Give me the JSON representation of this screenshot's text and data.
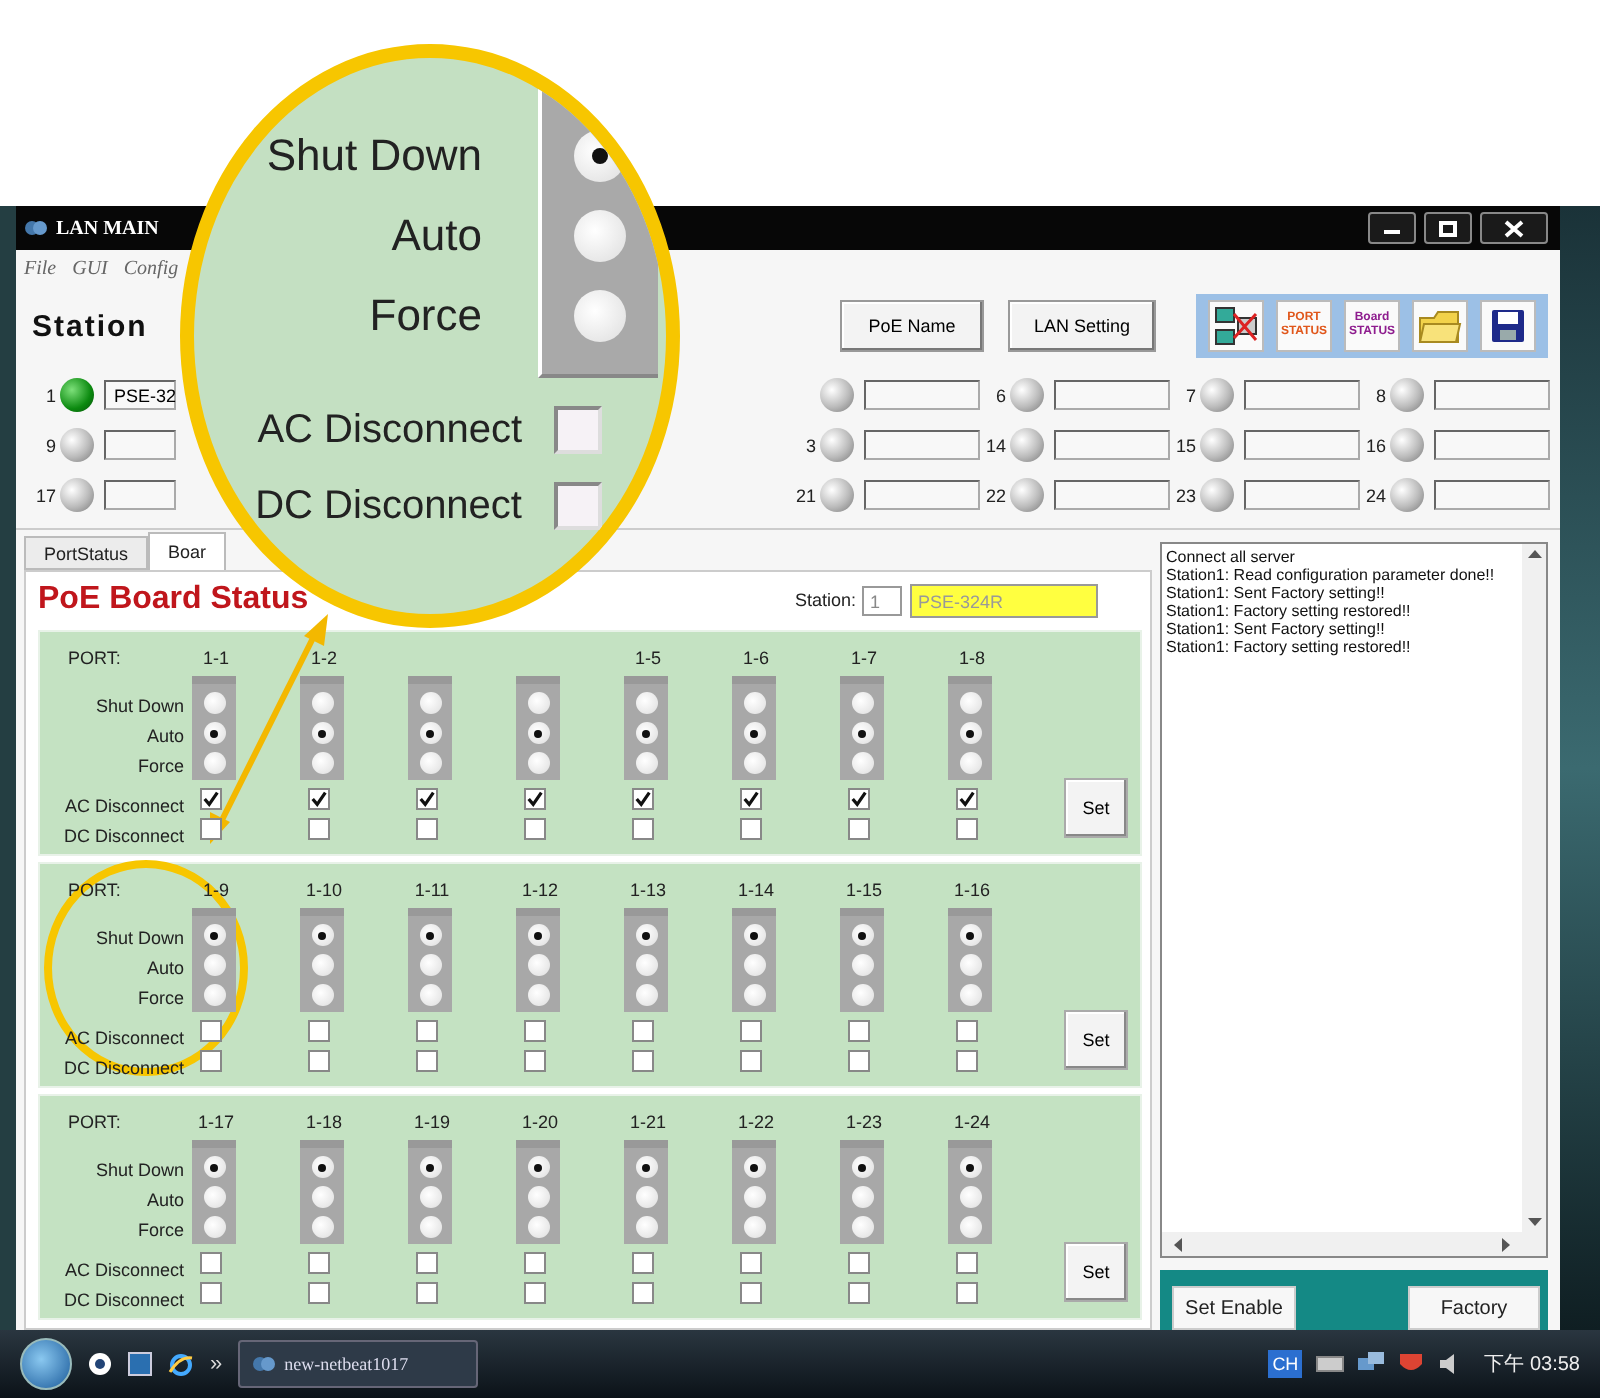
{
  "window": {
    "title": "LAN MAIN"
  },
  "menu": [
    "File",
    "GUI",
    "Config"
  ],
  "station_title": "Station",
  "toolbar_buttons": [
    "PoE Name",
    "LAN Setting"
  ],
  "icon_toolbar": [
    {
      "kind": "network"
    },
    {
      "kind": "label",
      "text": "PORT STATUS",
      "color": "#e0561a"
    },
    {
      "kind": "label",
      "text": "Board STATUS",
      "color": "#8e1c8e"
    },
    {
      "kind": "folder"
    },
    {
      "kind": "save"
    }
  ],
  "station_leds": [
    {
      "left": [
        {
          "number": "1",
          "on": true,
          "value": "PSE-32"
        }
      ],
      "right": [
        {
          "on": false
        },
        {
          "number": "6",
          "on": false
        },
        {
          "number": "7",
          "on": false
        },
        {
          "number": "8",
          "on": false
        }
      ]
    },
    {
      "left": [
        {
          "number": "9",
          "on": false
        }
      ],
      "right": [
        {
          "number": "3",
          "on": false
        },
        {
          "number": "14",
          "on": false
        },
        {
          "number": "15",
          "on": false
        },
        {
          "number": "16",
          "on": false
        }
      ]
    },
    {
      "left": [
        {
          "number": "17",
          "on": false
        }
      ],
      "right": [
        {
          "number": "21",
          "on": false
        },
        {
          "number": "22",
          "on": false
        },
        {
          "number": "23",
          "on": false
        },
        {
          "number": "24",
          "on": false
        }
      ]
    }
  ],
  "tabs": [
    {
      "label": "PortStatus",
      "selected": false
    },
    {
      "label": "Boar",
      "selected": true
    }
  ],
  "board": {
    "title": "PoE Board Status",
    "station_label": "Station:",
    "station": "1",
    "name": "PSE-324R"
  },
  "groups": [
    {
      "highlighted": false,
      "port_heading": "PORT:",
      "mode_labels": [
        "Shut Down",
        "Auto",
        "Force"
      ],
      "check_labels": [
        "AC Disconnect",
        "DC Disconnect"
      ],
      "button": "Set",
      "ports": [
        {
          "label": "1-1",
          "shut_down": false,
          "auto": true,
          "force": false,
          "ac": true,
          "dc": false
        },
        {
          "label": "1-2",
          "shut_down": false,
          "auto": true,
          "force": false,
          "ac": true,
          "dc": false
        },
        {
          "shut_down": false,
          "auto": true,
          "force": false,
          "ac": true,
          "dc": false
        },
        {
          "shut_down": false,
          "auto": true,
          "force": false,
          "ac": true,
          "dc": false
        },
        {
          "label": "1-5",
          "shut_down": false,
          "auto": true,
          "force": false,
          "ac": true,
          "dc": false
        },
        {
          "label": "1-6",
          "shut_down": false,
          "auto": true,
          "force": false,
          "ac": true,
          "dc": false
        },
        {
          "label": "1-7",
          "shut_down": false,
          "auto": true,
          "force": false,
          "ac": true,
          "dc": false
        },
        {
          "label": "1-8",
          "shut_down": false,
          "auto": true,
          "force": false,
          "ac": true,
          "dc": false
        }
      ]
    },
    {
      "highlighted": true,
      "port_heading": "PORT:",
      "mode_labels": [
        "Shut Down",
        "Auto",
        "Force"
      ],
      "check_labels": [
        "AC Disconnect",
        "DC Disconnect"
      ],
      "button": "Set",
      "ports": [
        {
          "label": "1-9",
          "shut_down": true,
          "auto": false,
          "force": false,
          "ac": false,
          "dc": false
        },
        {
          "label": "1-10",
          "shut_down": true,
          "auto": false,
          "force": false,
          "ac": false,
          "dc": false
        },
        {
          "label": "1-11",
          "shut_down": true,
          "auto": false,
          "force": false,
          "ac": false,
          "dc": false
        },
        {
          "label": "1-12",
          "shut_down": true,
          "auto": false,
          "force": false,
          "ac": false,
          "dc": false
        },
        {
          "label": "1-13",
          "shut_down": true,
          "auto": false,
          "force": false,
          "ac": false,
          "dc": false
        },
        {
          "label": "1-14",
          "shut_down": true,
          "auto": false,
          "force": false,
          "ac": false,
          "dc": false
        },
        {
          "label": "1-15",
          "shut_down": true,
          "auto": false,
          "force": false,
          "ac": false,
          "dc": false
        },
        {
          "label": "1-16",
          "shut_down": true,
          "auto": false,
          "force": false,
          "ac": false,
          "dc": false
        }
      ]
    },
    {
      "highlighted": false,
      "port_heading": "PORT:",
      "mode_labels": [
        "Shut Down",
        "Auto",
        "Force"
      ],
      "check_labels": [
        "AC Disconnect",
        "DC Disconnect"
      ],
      "button": "Set",
      "ports": [
        {
          "label": "1-17",
          "shut_down": true,
          "auto": false,
          "force": false,
          "ac": false,
          "dc": false
        },
        {
          "label": "1-18",
          "shut_down": true,
          "auto": false,
          "force": false,
          "ac": false,
          "dc": false
        },
        {
          "label": "1-19",
          "shut_down": true,
          "auto": false,
          "force": false,
          "ac": false,
          "dc": false
        },
        {
          "label": "1-20",
          "shut_down": true,
          "auto": false,
          "force": false,
          "ac": false,
          "dc": false
        },
        {
          "label": "1-21",
          "shut_down": true,
          "auto": false,
          "force": false,
          "ac": false,
          "dc": false
        },
        {
          "label": "1-22",
          "shut_down": true,
          "auto": false,
          "force": false,
          "ac": false,
          "dc": false
        },
        {
          "label": "1-23",
          "shut_down": true,
          "auto": false,
          "force": false,
          "ac": false,
          "dc": false
        },
        {
          "label": "1-24",
          "shut_down": true,
          "auto": false,
          "force": false,
          "ac": false,
          "dc": false
        }
      ]
    }
  ],
  "log": [
    "Connect all server",
    "Station1: Read configuration parameter done!!",
    "Station1: Sent Factory setting!!",
    "Station1: Factory setting restored!!",
    "Station1: Sent Factory setting!!",
    "Station1: Factory setting restored!!"
  ],
  "actions": [
    "Set Enable",
    "Factory"
  ],
  "taskbar": {
    "chevron": "»",
    "task": "new-netbeat1017",
    "language": "CH",
    "clock": "下午 03:58"
  },
  "magnifier": {
    "modes": [
      {
        "label": "Shut Down",
        "selected": true
      },
      {
        "label": "Auto",
        "selected": false
      },
      {
        "label": "Force",
        "selected": false
      }
    ],
    "checks": [
      {
        "label": "AC Disconnect",
        "checked": false
      },
      {
        "label": "DC Disconnect",
        "checked": false
      }
    ]
  }
}
